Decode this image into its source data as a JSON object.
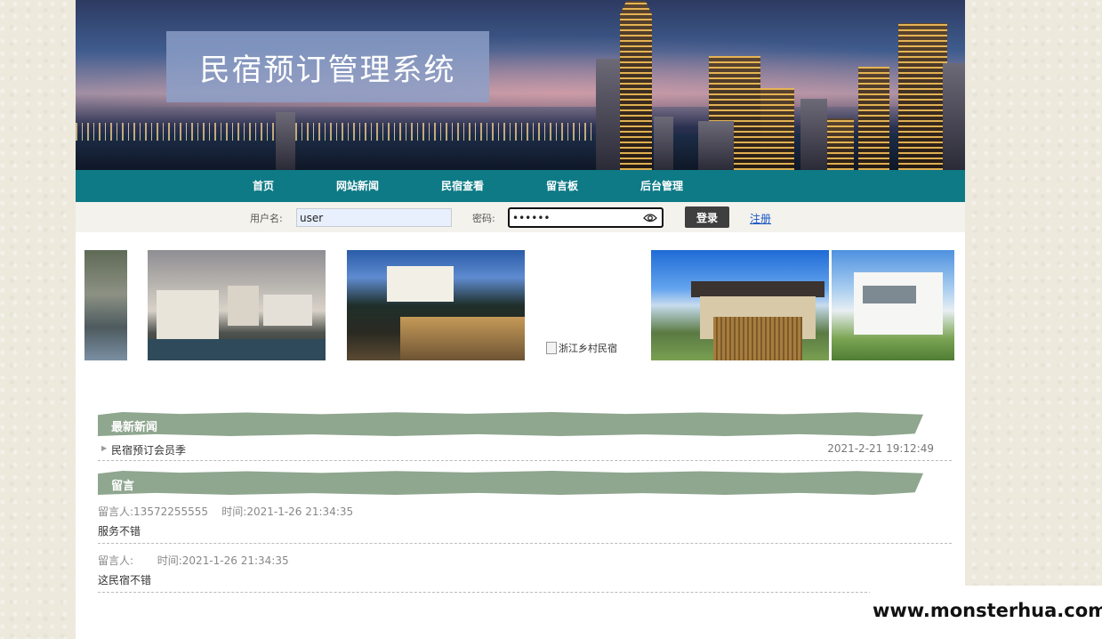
{
  "banner": {
    "title": "民宿预订管理系统"
  },
  "nav": {
    "items": [
      {
        "label": "首页"
      },
      {
        "label": "网站新闻"
      },
      {
        "label": "民宿查看"
      },
      {
        "label": "留言板"
      },
      {
        "label": "后台管理"
      }
    ]
  },
  "login": {
    "username_label": "用户名:",
    "username_value": "user",
    "password_label": "密码:",
    "password_value": "••••••",
    "login_button": "登录",
    "register_link": "注册"
  },
  "gallery": {
    "broken_image_alt": "浙江乡村民宿"
  },
  "news": {
    "section_title": "最新新闻",
    "items": [
      {
        "title": "民宿预订会员季",
        "date": "2021-2-21 19:12:49"
      }
    ]
  },
  "messages": {
    "section_title": "留言",
    "items": [
      {
        "meta": "留言人:13572255555    时间:2021-1-26 21:34:35",
        "content": "服务不错"
      },
      {
        "meta": "留言人:       时间:2021-1-26 21:34:35",
        "content": "这民宿不错"
      }
    ]
  },
  "watermark": "www.monsterhua.com",
  "colors": {
    "nav_bg": "#0d7a86",
    "section_header_bg": "#8fa68f",
    "login_button_bg": "#3f3f3f",
    "link": "#1a55c4"
  }
}
